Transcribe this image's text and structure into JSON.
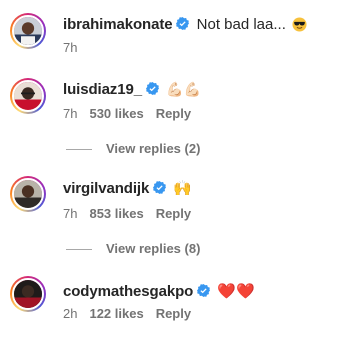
{
  "comments": [
    {
      "username": "ibrahimakonate",
      "text": "Not bad laa...",
      "emoji": "sunglasses-emoji",
      "time": "7h",
      "likes": "",
      "reply": ""
    },
    {
      "username": "luisdiaz19_",
      "text": "",
      "emoji_text": "💪🏻💪🏻",
      "time": "7h",
      "likes": "530 likes",
      "reply": "Reply",
      "view_replies": "View replies (2)"
    },
    {
      "username": "virgilvandijk",
      "text": "",
      "emoji_text": "🙌",
      "time": "7h",
      "likes": "853 likes",
      "reply": "Reply",
      "view_replies": "View replies (8)"
    },
    {
      "username": "codymathesgakpo",
      "text": "",
      "emoji_text": "❤️❤️",
      "time": "2h",
      "likes": "122 likes",
      "reply": "Reply"
    }
  ],
  "colors": {
    "verified": "#3897f0",
    "meta": "#737373",
    "text": "#262626"
  }
}
